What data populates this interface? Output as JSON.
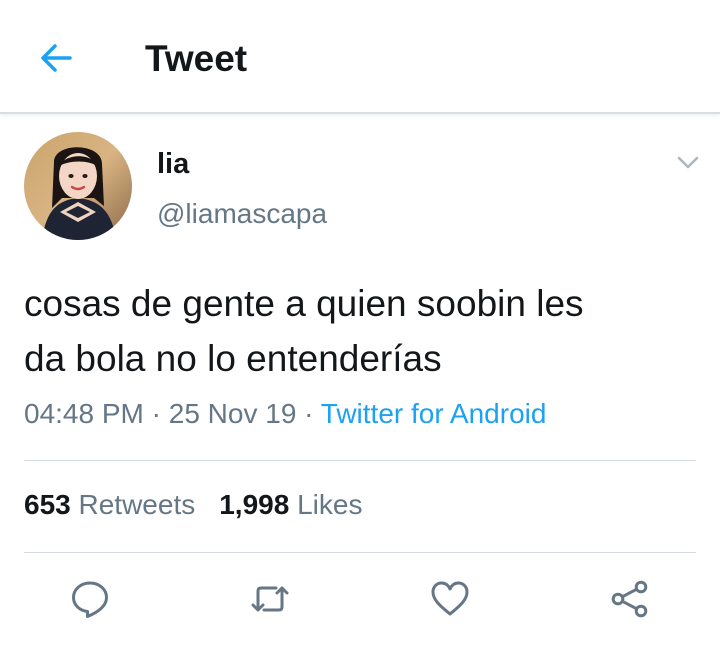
{
  "header": {
    "title": "Tweet",
    "back_icon": "arrow-left-icon"
  },
  "author": {
    "display_name": "lia",
    "handle": "@liamascapa"
  },
  "tweet": {
    "text": "cosas de gente a quien soobin les\nda bola no lo entenderías",
    "time": "04:48 PM",
    "separator": "·",
    "date": "25 Nov 19",
    "source": "Twitter for Android"
  },
  "stats": {
    "retweets_count": "653",
    "retweets_label": "Retweets",
    "likes_count": "1,998",
    "likes_label": "Likes"
  },
  "actions": [
    "reply-icon",
    "retweet-icon",
    "like-icon",
    "share-icon"
  ],
  "colors": {
    "accent": "#1da1f2",
    "text": "#14171a",
    "secondary": "#657786",
    "icon": "#657786"
  }
}
